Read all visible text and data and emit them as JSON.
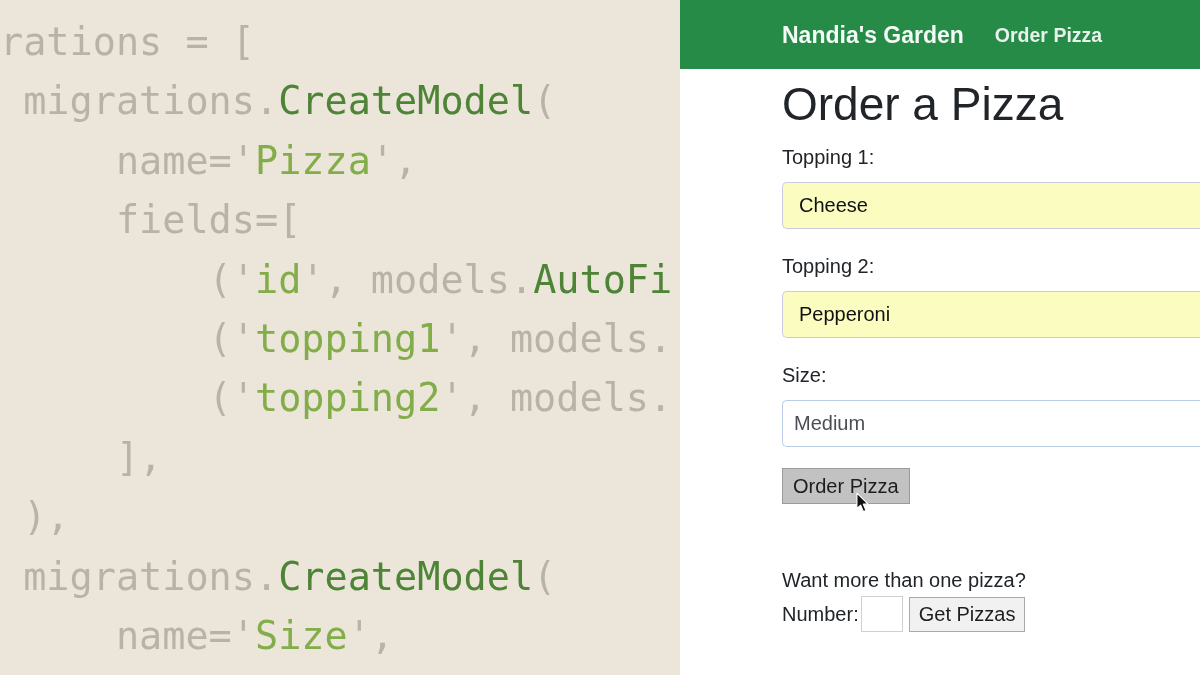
{
  "code_editor": {
    "lines": [
      {
        "tokens": [
          {
            "kind": "plain",
            "text": "rations = ["
          }
        ],
        "children": [
          {
            "tokens": [
              {
                "kind": "plain",
                "text": "migrations."
              },
              {
                "kind": "call",
                "text": "CreateModel"
              },
              {
                "kind": "plain",
                "text": "("
              }
            ],
            "children": [
              {
                "tokens": [
                  {
                    "kind": "plain",
                    "text": "name='"
                  },
                  {
                    "kind": "string",
                    "text": "Pizza"
                  },
                  {
                    "kind": "plain",
                    "text": "',"
                  }
                ]
              },
              {
                "tokens": [
                  {
                    "kind": "plain",
                    "text": "fields=["
                  }
                ],
                "children": [
                  {
                    "tokens": [
                      {
                        "kind": "plain",
                        "text": "('"
                      },
                      {
                        "kind": "string",
                        "text": "id"
                      },
                      {
                        "kind": "plain",
                        "text": "', models."
                      },
                      {
                        "kind": "call",
                        "text": "AutoFi"
                      }
                    ]
                  },
                  {
                    "tokens": [
                      {
                        "kind": "plain",
                        "text": "('"
                      },
                      {
                        "kind": "string",
                        "text": "topping1"
                      },
                      {
                        "kind": "plain",
                        "text": "', models."
                      }
                    ]
                  },
                  {
                    "tokens": [
                      {
                        "kind": "plain",
                        "text": "('"
                      },
                      {
                        "kind": "string",
                        "text": "topping2"
                      },
                      {
                        "kind": "plain",
                        "text": "', models."
                      }
                    ]
                  }
                ]
              },
              {
                "tokens": [
                  {
                    "kind": "plain",
                    "text": "],"
                  }
                ]
              }
            ]
          },
          {
            "tokens": [
              {
                "kind": "plain",
                "text": "),"
              }
            ]
          },
          {
            "tokens": [
              {
                "kind": "plain",
                "text": "migrations."
              },
              {
                "kind": "call",
                "text": "CreateModel"
              },
              {
                "kind": "plain",
                "text": "("
              }
            ],
            "children": [
              {
                "tokens": [
                  {
                    "kind": "plain",
                    "text": "name='"
                  },
                  {
                    "kind": "string",
                    "text": "Size"
                  },
                  {
                    "kind": "plain",
                    "text": "',"
                  }
                ]
              }
            ]
          }
        ]
      }
    ]
  },
  "browser": {
    "navbar": {
      "brand": "Nandia's Garden",
      "links": [
        {
          "label": "Order Pizza"
        }
      ]
    },
    "heading": "Order a Pizza",
    "form": {
      "fields": [
        {
          "label": "Topping 1:",
          "kind": "text",
          "value": "Cheese",
          "autofilled": true
        },
        {
          "label": "Topping 2:",
          "kind": "text",
          "value": "Pepperoni",
          "autofilled": true
        },
        {
          "label": "Size:",
          "kind": "select",
          "value": "Medium",
          "autofilled": false
        }
      ],
      "submit": "Order Pizza"
    },
    "multiple": {
      "prompt": "Want more than one pizza?",
      "number_label": "Number:",
      "button": "Get Pizzas"
    }
  }
}
